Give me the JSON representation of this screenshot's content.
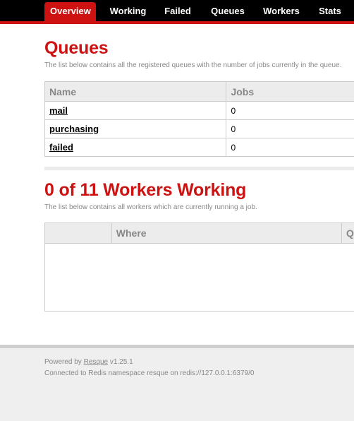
{
  "nav": {
    "tabs": [
      {
        "label": "Overview",
        "active": true
      },
      {
        "label": "Working",
        "active": false
      },
      {
        "label": "Failed",
        "active": false
      },
      {
        "label": "Queues",
        "active": false
      },
      {
        "label": "Workers",
        "active": false
      },
      {
        "label": "Stats",
        "active": false
      }
    ]
  },
  "queues": {
    "title": "Queues",
    "description": "The list below contains all the registered queues with the number of jobs currently in the queue.",
    "columns": [
      "Name",
      "Jobs"
    ],
    "rows": [
      {
        "name": "mail",
        "jobs": "0"
      },
      {
        "name": "purchasing",
        "jobs": "0"
      },
      {
        "name": "failed",
        "jobs": "0"
      }
    ]
  },
  "workers": {
    "title": "0 of 11 Workers Working",
    "description": "The list below contains all workers which are currently running a job.",
    "columns": [
      "",
      "Where",
      "Queue"
    ]
  },
  "footer": {
    "powered_prefix": "Powered by ",
    "powered_link": "Resque",
    "powered_suffix": " v1.25.1",
    "connection": "Connected to Redis namespace resque on redis://127.0.0.1:6379/0"
  },
  "colors": {
    "accent": "#ce1212",
    "nav_bg": "#000000",
    "footer_bg": "#efefef"
  }
}
